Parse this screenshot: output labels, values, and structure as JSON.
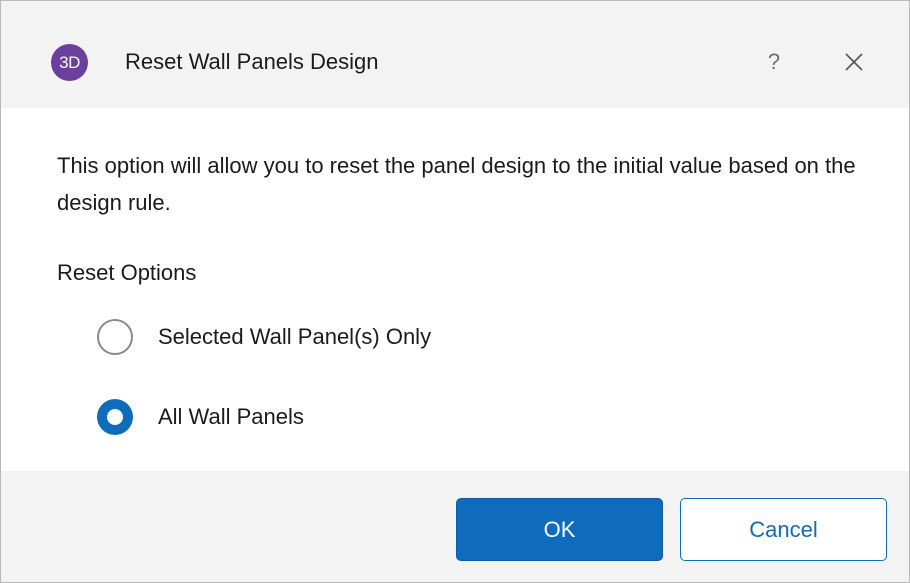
{
  "window": {
    "app_icon_text": "3D",
    "title": "Reset Wall Panels Design",
    "help_label": "?",
    "close_icon": "close-icon"
  },
  "body": {
    "description": "This option will allow you to reset the panel design to the initial value based on the design rule.",
    "options_label": "Reset Options",
    "options": [
      {
        "label": "Selected Wall Panel(s) Only",
        "checked": false
      },
      {
        "label": "All Wall Panels",
        "checked": true
      }
    ]
  },
  "footer": {
    "ok_label": "OK",
    "cancel_label": "Cancel"
  },
  "colors": {
    "accent": "#0f6cbd",
    "app_icon": "#6a3f9e"
  }
}
